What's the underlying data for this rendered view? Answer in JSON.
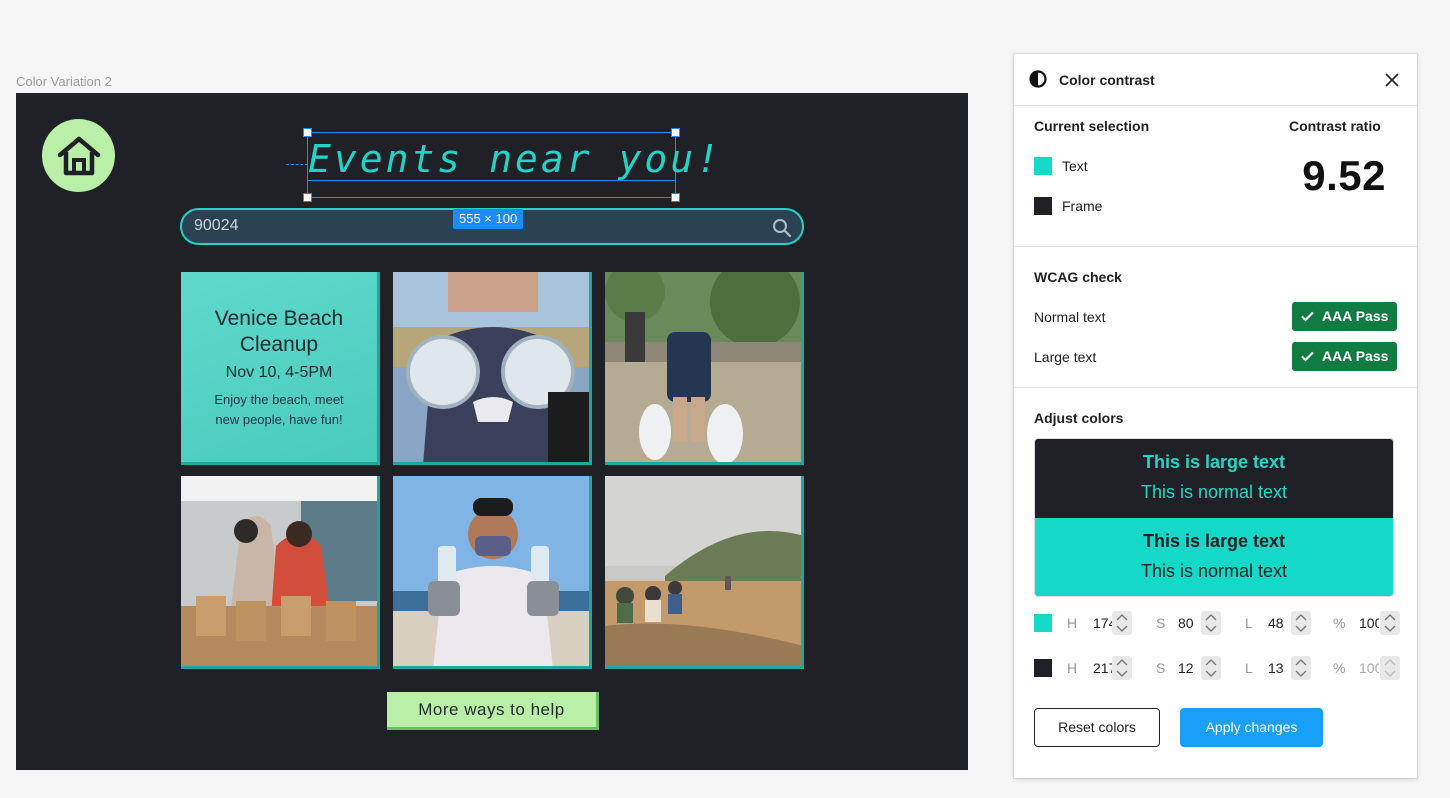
{
  "canvas": {
    "frame_label": "Color Variation 2",
    "title": "Events near you!",
    "dimension_badge": "555 × 100",
    "search_value": "90024",
    "event_card": {
      "title": "Venice Beach Cleanup",
      "date": "Nov 10, 4-5PM",
      "description": "Enjoy the beach, meet new people, have fun!"
    },
    "more_button": "More ways to help"
  },
  "panel": {
    "title": "Color contrast",
    "current_selection_label": "Current selection",
    "contrast_ratio_label": "Contrast ratio",
    "text_label": "Text",
    "frame_label": "Frame",
    "ratio_value": "9.52",
    "wcag_title": "WCAG check",
    "normal_text_label": "Normal text",
    "large_text_label": "Large text",
    "normal_badge": "AAA Pass",
    "large_badge": "AAA Pass",
    "adjust_title": "Adjust colors",
    "preview_large": "This is large text",
    "preview_normal": "This is normal text",
    "text_color": {
      "h": "174",
      "s": "80",
      "l": "48",
      "a": "100",
      "hex": "#14d9c8"
    },
    "frame_color": {
      "h": "217",
      "s": "12",
      "l": "13",
      "a": "100",
      "hex": "#1f2126"
    },
    "labels": {
      "h": "H",
      "s": "S",
      "l": "L",
      "a": "%"
    },
    "reset_button": "Reset colors",
    "apply_button": "Apply changes"
  },
  "colors": {
    "accent": "#18a0fb",
    "pass_green": "#107c41",
    "teal": "#22d3c8",
    "dark": "#1f2126",
    "lime": "#b9efa6"
  }
}
